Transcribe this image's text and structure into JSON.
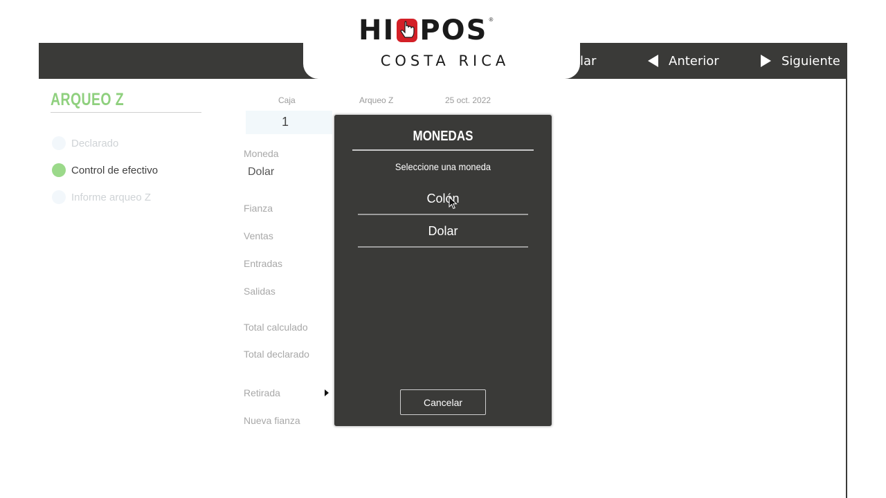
{
  "logo": {
    "brand_top": "HIPOS",
    "brand_left": "HI",
    "brand_right": "POS",
    "registered": "®",
    "brand_bottom": "COSTA RICA",
    "accent_color": "#d32027"
  },
  "toolbar": {
    "partial_label": "lar",
    "prev_label": "Anterior",
    "next_label": "Siguiente",
    "background": "#3a3a38"
  },
  "sidebar": {
    "title": "ARQUEO Z",
    "steps": [
      {
        "label": "Declarado",
        "state": "inactive"
      },
      {
        "label": "Control de efectivo",
        "state": "active"
      },
      {
        "label": "Informe arqueo Z",
        "state": "inactive"
      }
    ],
    "accent_color": "#8fd07e"
  },
  "header": {
    "caja_label": "Caja",
    "caja_value": "1",
    "arqueo_label": "Arqueo Z",
    "date": "25 oct. 2022"
  },
  "form": {
    "moneda_label": "Moneda",
    "moneda_value": "Dolar",
    "fields": [
      "Fianza",
      "Ventas",
      "Entradas",
      "Salidas",
      "Total calculado",
      "Total declarado",
      "Retirada",
      "Nueva fianza"
    ]
  },
  "modal": {
    "title": "MONEDAS",
    "subtitle": "Seleccione una moneda",
    "options": [
      "Colón",
      "Dolar"
    ],
    "cancel_label": "Cancelar"
  }
}
